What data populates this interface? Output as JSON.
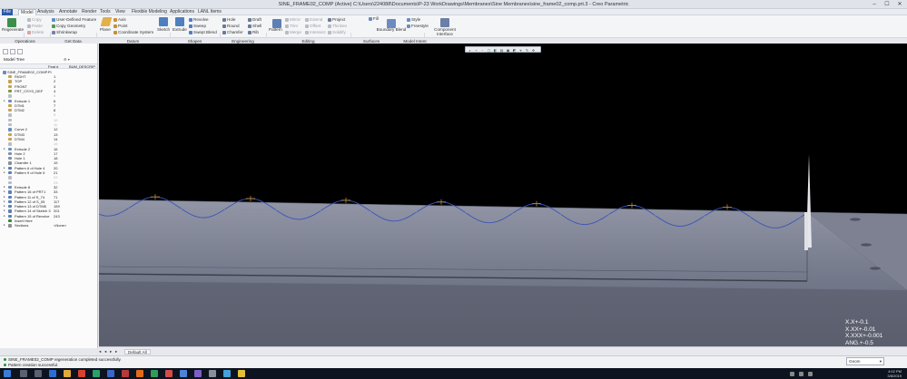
{
  "window": {
    "title": "SINE_FRAME02_COMP (Active) C:\\Users\\224088\\Documents\\P-23 WorkDrawings\\Membranes\\Sine Membranes\\sine_frame02_comp.prt.3 - Creo Parametric"
  },
  "menus": [
    "File",
    "Model",
    "Analysis",
    "Annotate",
    "Render",
    "Tools",
    "View",
    "Flexible Modeling",
    "Applications",
    "LANL Items"
  ],
  "ribbon": {
    "regenerate": "Regenerate",
    "operations": {
      "copy": "Copy",
      "paste": "Paste",
      "delete": "Delete"
    },
    "getdata": {
      "udf": "User-Defined Feature",
      "copygeom": "Copy Geometry",
      "shrinkwrap": "Shrinkwrap"
    },
    "datum": {
      "plane": "Plane",
      "axis": "Axis",
      "point": "Point",
      "csys": "Coordinate System",
      "sketch": "Sketch"
    },
    "shapes": {
      "extrude": "Extrude",
      "revolve": "Revolve",
      "sweep": "Sweep",
      "swept_blend": "Swept Blend"
    },
    "engineering": {
      "hole": "Hole",
      "round": "Round",
      "chamfer": "Chamfer",
      "draft": "Draft",
      "shell": "Shell",
      "rib": "Rib"
    },
    "editing": {
      "pattern": "Pattern",
      "mirror": "Mirror",
      "trim": "Trim",
      "merge": "Merge",
      "extend": "Extend",
      "offset": "Offset",
      "intersect": "Intersect",
      "project": "Project",
      "thicken": "Thicken",
      "solidify": "Solidify"
    },
    "surfaces": {
      "fill": "Fill",
      "style": "Style",
      "freestyle": "Freestyle",
      "boundary_blend": "Boundary Blend"
    },
    "model_intent": {
      "component_interface": "Component Interface"
    },
    "groups": {
      "operations": "Operations",
      "get_data": "Get Data",
      "datum": "Datum",
      "shapes": "Shapes",
      "engineering": "Engineering",
      "editing": "Editing",
      "surfaces": "Surfaces",
      "model_intent": "Model Intent"
    }
  },
  "tree": {
    "title": "Model Tree",
    "col_feat": "Feat #",
    "col_desc": "BUM_DESCRIP",
    "root": "SINE_FRAME02_COMP.PI",
    "rows": [
      {
        "label": "RIGHT",
        "fid": "1",
        "color": "#c8a24a"
      },
      {
        "label": "TOP",
        "fid": "2",
        "color": "#c8a24a"
      },
      {
        "label": "FRONT",
        "fid": "3",
        "color": "#c8a24a"
      },
      {
        "label": "PRT_CSYS_DEF",
        "fid": "4",
        "color": "#7a9a3a"
      },
      {
        "label": "",
        "fid": "5",
        "color": "#b9bec5",
        "dim": true
      },
      {
        "label": "Extrude 1",
        "fid": "6",
        "color": "#6b8fc9",
        "tw": true
      },
      {
        "label": "DTM1",
        "fid": "7",
        "color": "#c8a24a"
      },
      {
        "label": "DTM2",
        "fid": "8",
        "color": "#c8a24a"
      },
      {
        "label": "",
        "fid": "9",
        "color": "#b9bec5",
        "dim": true
      },
      {
        "label": "",
        "fid": "10",
        "color": "#b9bec5",
        "dim": true
      },
      {
        "label": "",
        "fid": "11",
        "color": "#b9bec5",
        "dim": true
      },
      {
        "label": "Curve 2",
        "fid": "12",
        "color": "#6a8fb6"
      },
      {
        "label": "DTM3",
        "fid": "13",
        "color": "#c8a24a"
      },
      {
        "label": "DTM4",
        "fid": "14",
        "color": "#c8a24a"
      },
      {
        "label": "",
        "fid": "15",
        "color": "#b9bec5",
        "dim": true
      },
      {
        "label": "Extrude 2",
        "fid": "16",
        "color": "#6b8fc9",
        "tw": true
      },
      {
        "label": "Hole 2",
        "fid": "17",
        "color": "#7f8fa6"
      },
      {
        "label": "Hole 1",
        "fid": "18",
        "color": "#7f8fa6"
      },
      {
        "label": "Chamfer 1",
        "fid": "19",
        "color": "#8a8f96"
      },
      {
        "label": "Pattern 6 of Hole 4",
        "fid": "20",
        "color": "#5c7fb5",
        "tw": true
      },
      {
        "label": "Pattern 9 of Hole 5",
        "fid": "21",
        "color": "#5c7fb5",
        "tw": true
      },
      {
        "label": "",
        "fid": "22",
        "color": "#b9bec5",
        "dim": true
      },
      {
        "label": "",
        "fid": "23",
        "color": "#b9bec5",
        "dim": true
      },
      {
        "label": "Extrude 8",
        "fid": "32",
        "color": "#6b8fc9",
        "tw": true
      },
      {
        "label": "Pattern 16 of PRT1",
        "fid": "33",
        "color": "#5c7fb5",
        "tw": true
      },
      {
        "label": "Pattern 11 of S_74",
        "fid": "71",
        "color": "#5c7fb5",
        "tw": true
      },
      {
        "label": "Pattern 12 of S_05",
        "fid": "117",
        "color": "#5c7fb5",
        "tw": true
      },
      {
        "label": "Pattern 13 of DTM5",
        "fid": "159",
        "color": "#5c7fb5",
        "tw": true
      },
      {
        "label": "Pattern 14 of Sketch 3",
        "fid": "201",
        "color": "#5c7fb5",
        "tw": true
      },
      {
        "label": "Pattern 15 of Revolve",
        "fid": "243",
        "color": "#5c7fb5",
        "tw": true
      },
      {
        "label": "Insert Here",
        "fid": "",
        "color": "#2f8a3c",
        "insert": true
      },
      {
        "label": "Sections",
        "fid": "",
        "desc": "<None>",
        "color": "#8a8f96",
        "tw": true
      }
    ]
  },
  "viewport": {
    "tolerances": [
      "X.X+-0.1",
      "X.XX+-0.01",
      "X.XXX+-0.001",
      "ANG.+-0.5"
    ]
  },
  "bottom": {
    "layer_label": "Default All"
  },
  "messages": [
    "SINE_FRAME02_COMP regeneration completed successfully.",
    "Pattern creation successful."
  ],
  "status": {
    "filter": "Geom",
    "time": "4:02 PM",
    "date": "3/8/2019"
  }
}
